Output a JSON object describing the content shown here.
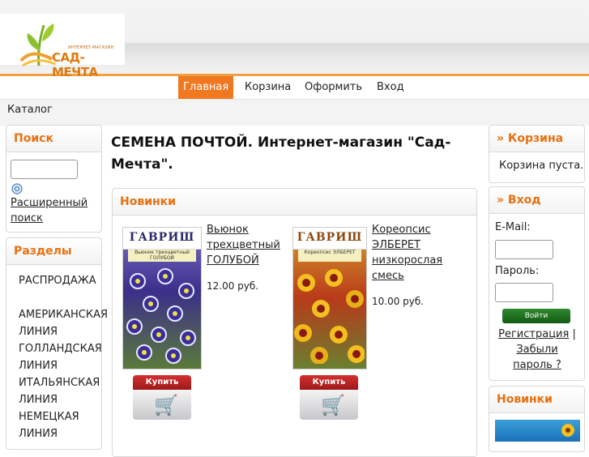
{
  "logo": {
    "line1": "ИНТЕРНЕТ-МАГАЗИН",
    "line2": "САД-МЕЧТА"
  },
  "nav": {
    "items": [
      "Главная",
      "Корзина",
      "Оформить",
      "Вход"
    ]
  },
  "breadcrumb": {
    "text": "Каталог"
  },
  "search": {
    "title": "Поиск",
    "advanced_link": "Расширенный поиск"
  },
  "sections": {
    "title": "Разделы",
    "items": [
      "РАСПРОДАЖА",
      "АМЕРИКАНСКАЯ ЛИНИЯ",
      "ГОЛЛАНДСКАЯ ЛИНИЯ",
      "ИТАЛЬЯНСКАЯ ЛИНИЯ",
      "НЕМЕЦКАЯ ЛИНИЯ"
    ]
  },
  "main": {
    "title": "СЕМЕНА ПОЧТОЙ. Интернет-магазин \"Сад-Мечта\".",
    "new_items_title": "Новинки",
    "products": [
      {
        "name": "Вьюнок трехцветный ГОЛУБОЙ",
        "price": "12.00 руб.",
        "brand": "ГАВРИШ",
        "pack_label": "Вьюнок трехцветный ГОЛУБОЙ",
        "buy": "Купить",
        "cart_icon": "cart-icon"
      },
      {
        "name": "Кореопсис ЭЛБЕРЕТ низкорослая смесь",
        "price": "10.00 руб.",
        "brand": "ГАВРИШ",
        "pack_label": "Кореопсис ЭЛБЕРЕТ",
        "buy": "Купить",
        "cart_icon": "cart-icon"
      }
    ]
  },
  "cart": {
    "title": "» Корзина",
    "empty_text": "Корзина пуста."
  },
  "login": {
    "title": "» Вход",
    "email_label": "E-Mail:",
    "password_label": "Пароль:",
    "submit_label": "Войти",
    "register_link": "Регистрация",
    "separator": "|",
    "forgot_link": "Забыли пароль ?"
  },
  "right_new": {
    "title": "Новинки"
  },
  "colors": {
    "accent": "#f07820",
    "heading": "#e87010",
    "buy": "#c02020",
    "login_button": "#1e7a1e"
  }
}
